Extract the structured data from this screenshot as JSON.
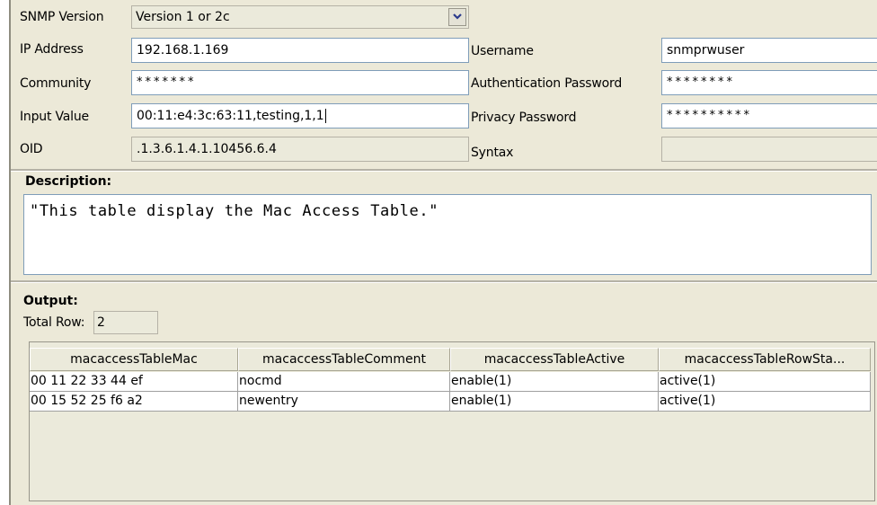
{
  "snmp": {
    "version_label": "SNMP Version",
    "version_value": "Version 1 or 2c",
    "ip_label": "IP Address",
    "ip_value": "192.168.1.169",
    "community_label": "Community",
    "community_value": "*******",
    "input_label": "Input Value",
    "input_value": "00:11:e4:3c:63:11,testing,1,1",
    "oid_label": "OID",
    "oid_value": ".1.3.6.1.4.1.10456.6.4",
    "username_label": "Username",
    "username_value": "snmprwuser",
    "auth_label": "Authentication Password",
    "auth_value": "********",
    "privacy_label": "Privacy Password",
    "privacy_value": "**********",
    "syntax_label": "Syntax",
    "syntax_value": ""
  },
  "description": {
    "title": "Description:",
    "text": "\"This table display the Mac Access Table.\""
  },
  "output": {
    "title": "Output:",
    "total_row_label": "Total Row:",
    "total_row_value": "2",
    "columns": [
      "macaccessTableMac",
      "macaccessTableComment",
      "macaccessTableActive",
      "macaccessTableRowSta..."
    ],
    "rows": [
      [
        "00 11 22 33 44 ef",
        "nocmd",
        "enable(1)",
        "active(1)"
      ],
      [
        "00 15 52 25 f6 a2",
        "newentry",
        "enable(1)",
        "active(1)"
      ]
    ]
  },
  "icons": {
    "dropdown": "chevron-down-icon"
  },
  "colors": {
    "panel": "#ece9d8",
    "field_border": "#7f9db9",
    "readonly": "#ebeadb"
  }
}
